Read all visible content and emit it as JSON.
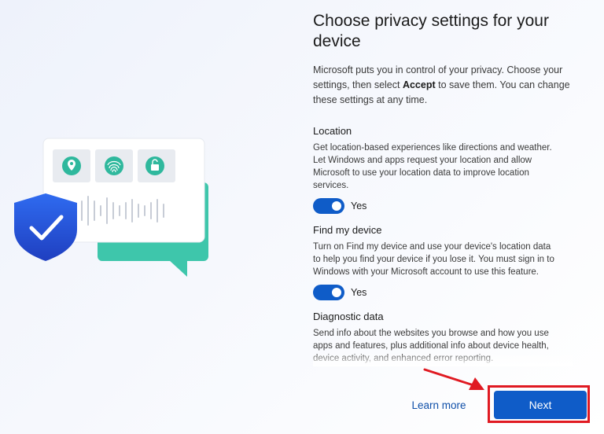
{
  "page": {
    "title": "Choose privacy settings for your device",
    "intro_before": "Microsoft puts you in control of your privacy. Choose your settings, then select ",
    "intro_bold": "Accept",
    "intro_after": " to save them. You can change these settings at any time."
  },
  "settings": [
    {
      "title": "Location",
      "description": "Get location-based experiences like directions and weather. Let Windows and apps request your location and allow Microsoft to use your location data to improve location services.",
      "state": "Yes"
    },
    {
      "title": "Find my device",
      "description": "Turn on Find my device and use your device's location data to help you find your device if you lose it. You must sign in to Windows with your Microsoft account to use this feature.",
      "state": "Yes"
    },
    {
      "title": "Diagnostic data",
      "description": "Send info about the websites you browse and how you use apps and features, plus additional info about device health, device activity, and enhanced error reporting."
    }
  ],
  "footer": {
    "learn_more": "Learn more",
    "next": "Next"
  },
  "colors": {
    "accent": "#0f5cc8",
    "highlight": "#e01a22",
    "teal": "#3cc3a8"
  },
  "icons": [
    "location-pin-icon",
    "fingerprint-icon",
    "unlock-icon",
    "shield-check-icon"
  ]
}
